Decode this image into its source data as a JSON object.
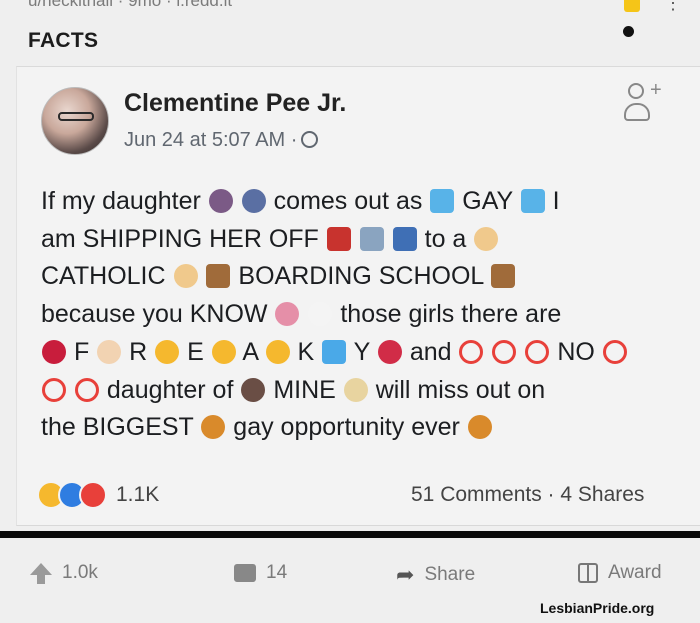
{
  "topbar": {
    "subreddit_meta": "u/neckithall · 9mo · i.redd.it"
  },
  "post": {
    "flair": "FACTS"
  },
  "fb": {
    "author": "Clementine Pee Jr.",
    "meta": "Jun 24 at 5:07 AM ·",
    "lines": [
      [
        "If my daughter",
        "emoji:girl",
        "emoji:woman",
        "comes out as",
        "emoji:rainbow",
        "GAY",
        "emoji:rainbow",
        "I"
      ],
      [
        "am SHIPPING HER OFF",
        "emoji:train",
        "emoji:plane",
        "emoji:mailbox",
        "to a",
        "emoji:angel"
      ],
      [
        "CATHOLIC",
        "emoji:angel",
        "emoji:church",
        "BOARDING SCHOOL",
        "emoji:church"
      ],
      [
        "because you KNOW",
        "emoji:brain",
        "emoji:eyes",
        "those girls there are"
      ],
      [
        "emoji:tongue",
        "F",
        "emoji:fingers",
        "R",
        "emoji:shock",
        "E",
        "emoji:weary",
        "A",
        "emoji:hearteyes",
        "K",
        "emoji:drops",
        "Y",
        "emoji:lips",
        "and",
        "emoji:no",
        "emoji:no",
        "emoji:no",
        "NO",
        "emoji:no"
      ],
      [
        "emoji:no",
        "emoji:no",
        "daughter of",
        "emoji:woman2",
        "MINE",
        "emoji:scream",
        "will miss out on"
      ],
      [
        "the BIGGEST",
        "emoji:couple",
        "gay opportunity ever",
        "emoji:couple"
      ]
    ],
    "reaction_count": "1.1K",
    "stats": "51 Comments · 4 Shares"
  },
  "actions": {
    "upvotes": "1.0k",
    "comments": "14",
    "share": "Share",
    "award": "Award"
  },
  "watermark": "LesbianPride.org",
  "colors": {
    "emoji": {
      "girl": "#7b5a86",
      "woman": "#5a6fa3",
      "rainbow": "#58b3e8",
      "train": "#c8332e",
      "plane": "#8aa4c0",
      "mailbox": "#3f6fb5",
      "angel": "#f0c98c",
      "church": "#a06b3a",
      "brain": "#e58fa8",
      "eyes": "#f4f4f4",
      "tongue": "#c81d3c",
      "fingers": "#f2d3b2",
      "shock": "#f5b82e",
      "weary": "#f5b82e",
      "hearteyes": "#f5b82e",
      "drops": "#4aa9e8",
      "lips": "#d12c47",
      "no": "#e8403a",
      "woman2": "#6a4e45",
      "scream": "#e8d4a0",
      "couple": "#d98a2b"
    },
    "reactions": [
      "#f5b82e",
      "#2f7de1",
      "#e8403a"
    ]
  }
}
